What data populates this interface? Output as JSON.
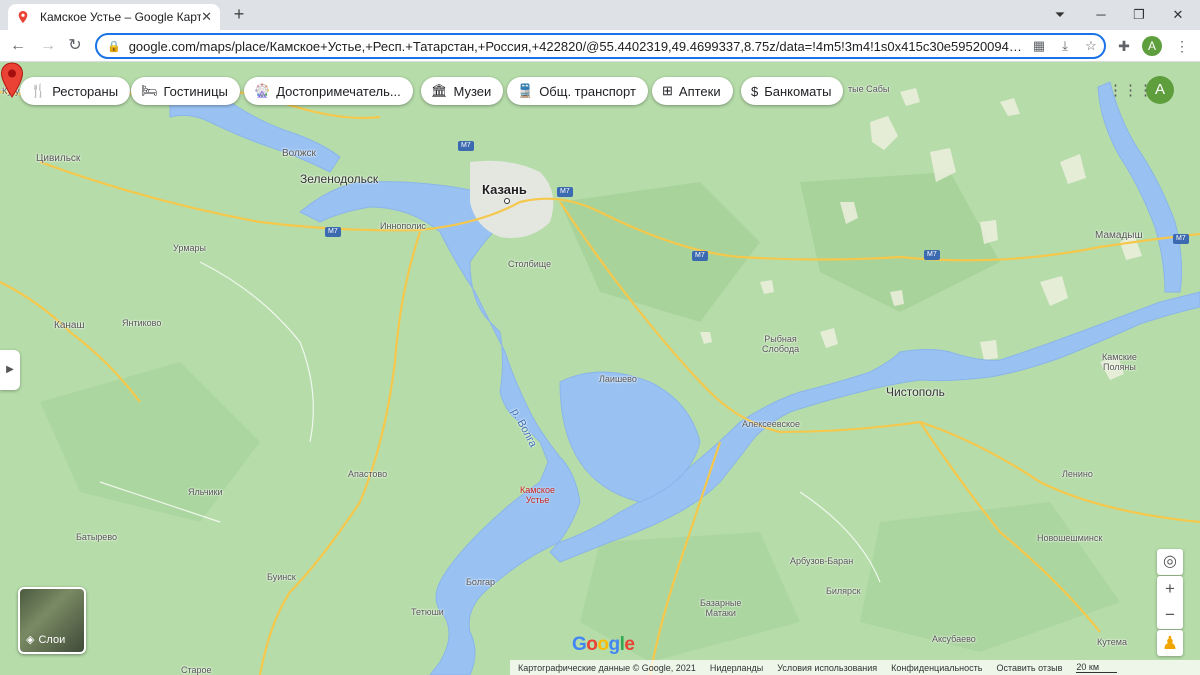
{
  "browser": {
    "tab_title": "Камское Устье – Google Карты",
    "tab_close": "✕",
    "new_tab": "+",
    "url": "google.com/maps/place/Камское+Устье,+Респ.+Татарстан,+Россия,+422820/@55.4402319,49.4699337,8.75z/data=!4m5!3m4!1s0x415c30e595200945:0xf2fbfb3...",
    "profile_initial": "A"
  },
  "categories": [
    {
      "label": "Рестораны",
      "icon": "fork-knife-icon",
      "glyph": "🍴"
    },
    {
      "label": "Гостиницы",
      "icon": "bed-icon",
      "glyph": "🛏"
    },
    {
      "label": "Достопримечатель...",
      "icon": "attraction-icon",
      "glyph": "🎡"
    },
    {
      "label": "Музеи",
      "icon": "museum-icon",
      "glyph": "🏛"
    },
    {
      "label": "Общ. транспорт",
      "icon": "transit-icon",
      "glyph": "🚆"
    },
    {
      "label": "Аптеки",
      "icon": "pharmacy-icon",
      "glyph": "⊞"
    },
    {
      "label": "Банкоматы",
      "icon": "atm-icon",
      "glyph": "$"
    }
  ],
  "map": {
    "places": {
      "kazan": "Казань",
      "chistopol": "Чистополь",
      "zelenodolsk": "Зеленодольск",
      "volzhsk": "Волжск",
      "tsivilsk": "Цивильск",
      "kanash": "Канаш",
      "mamadysh": "Мамадыш",
      "urmary": "Урмары",
      "yantikovo": "Янтиково",
      "innopolis": "Иннополис",
      "stolbishche": "Столбище",
      "rybnaya": "Рыбная\nСлобода",
      "laishevo": "Лаишево",
      "alekseevskoe": "Алексеевское",
      "apastovo": "Апастово",
      "yalchiki": "Яльчики",
      "batyrevo": "Батырево",
      "buinsk": "Буинск",
      "bolgar": "Болгар",
      "tetyushi": "Тетюши",
      "bazarnye": "Базарные\nМатаки",
      "bilyarsk": "Билярск",
      "arbuzov": "Арбузов-Баран",
      "novosheshminsk": "Новошешминск",
      "lenino": "Ленино",
      "aksubaevo": "Аксубаево",
      "kutema": "Кутема",
      "kamskie": "Камские\nПоляны",
      "sabi": "тые Сабы",
      "kugu": "Кугу",
      "starye": "Старое",
      "river": "р. Волга",
      "pin_label": "Камское\nУстье"
    },
    "highway": "M7"
  },
  "controls": {
    "layers_label": "Слои",
    "zoom_in": "+",
    "zoom_out": "−"
  },
  "footer": {
    "copyright": "Картографические данные © Google, 2021",
    "region": "Нидерланды",
    "terms": "Условия использования",
    "privacy": "Конфиденциальность",
    "feedback": "Оставить отзыв",
    "scale": "20 км"
  },
  "logo": "Google"
}
